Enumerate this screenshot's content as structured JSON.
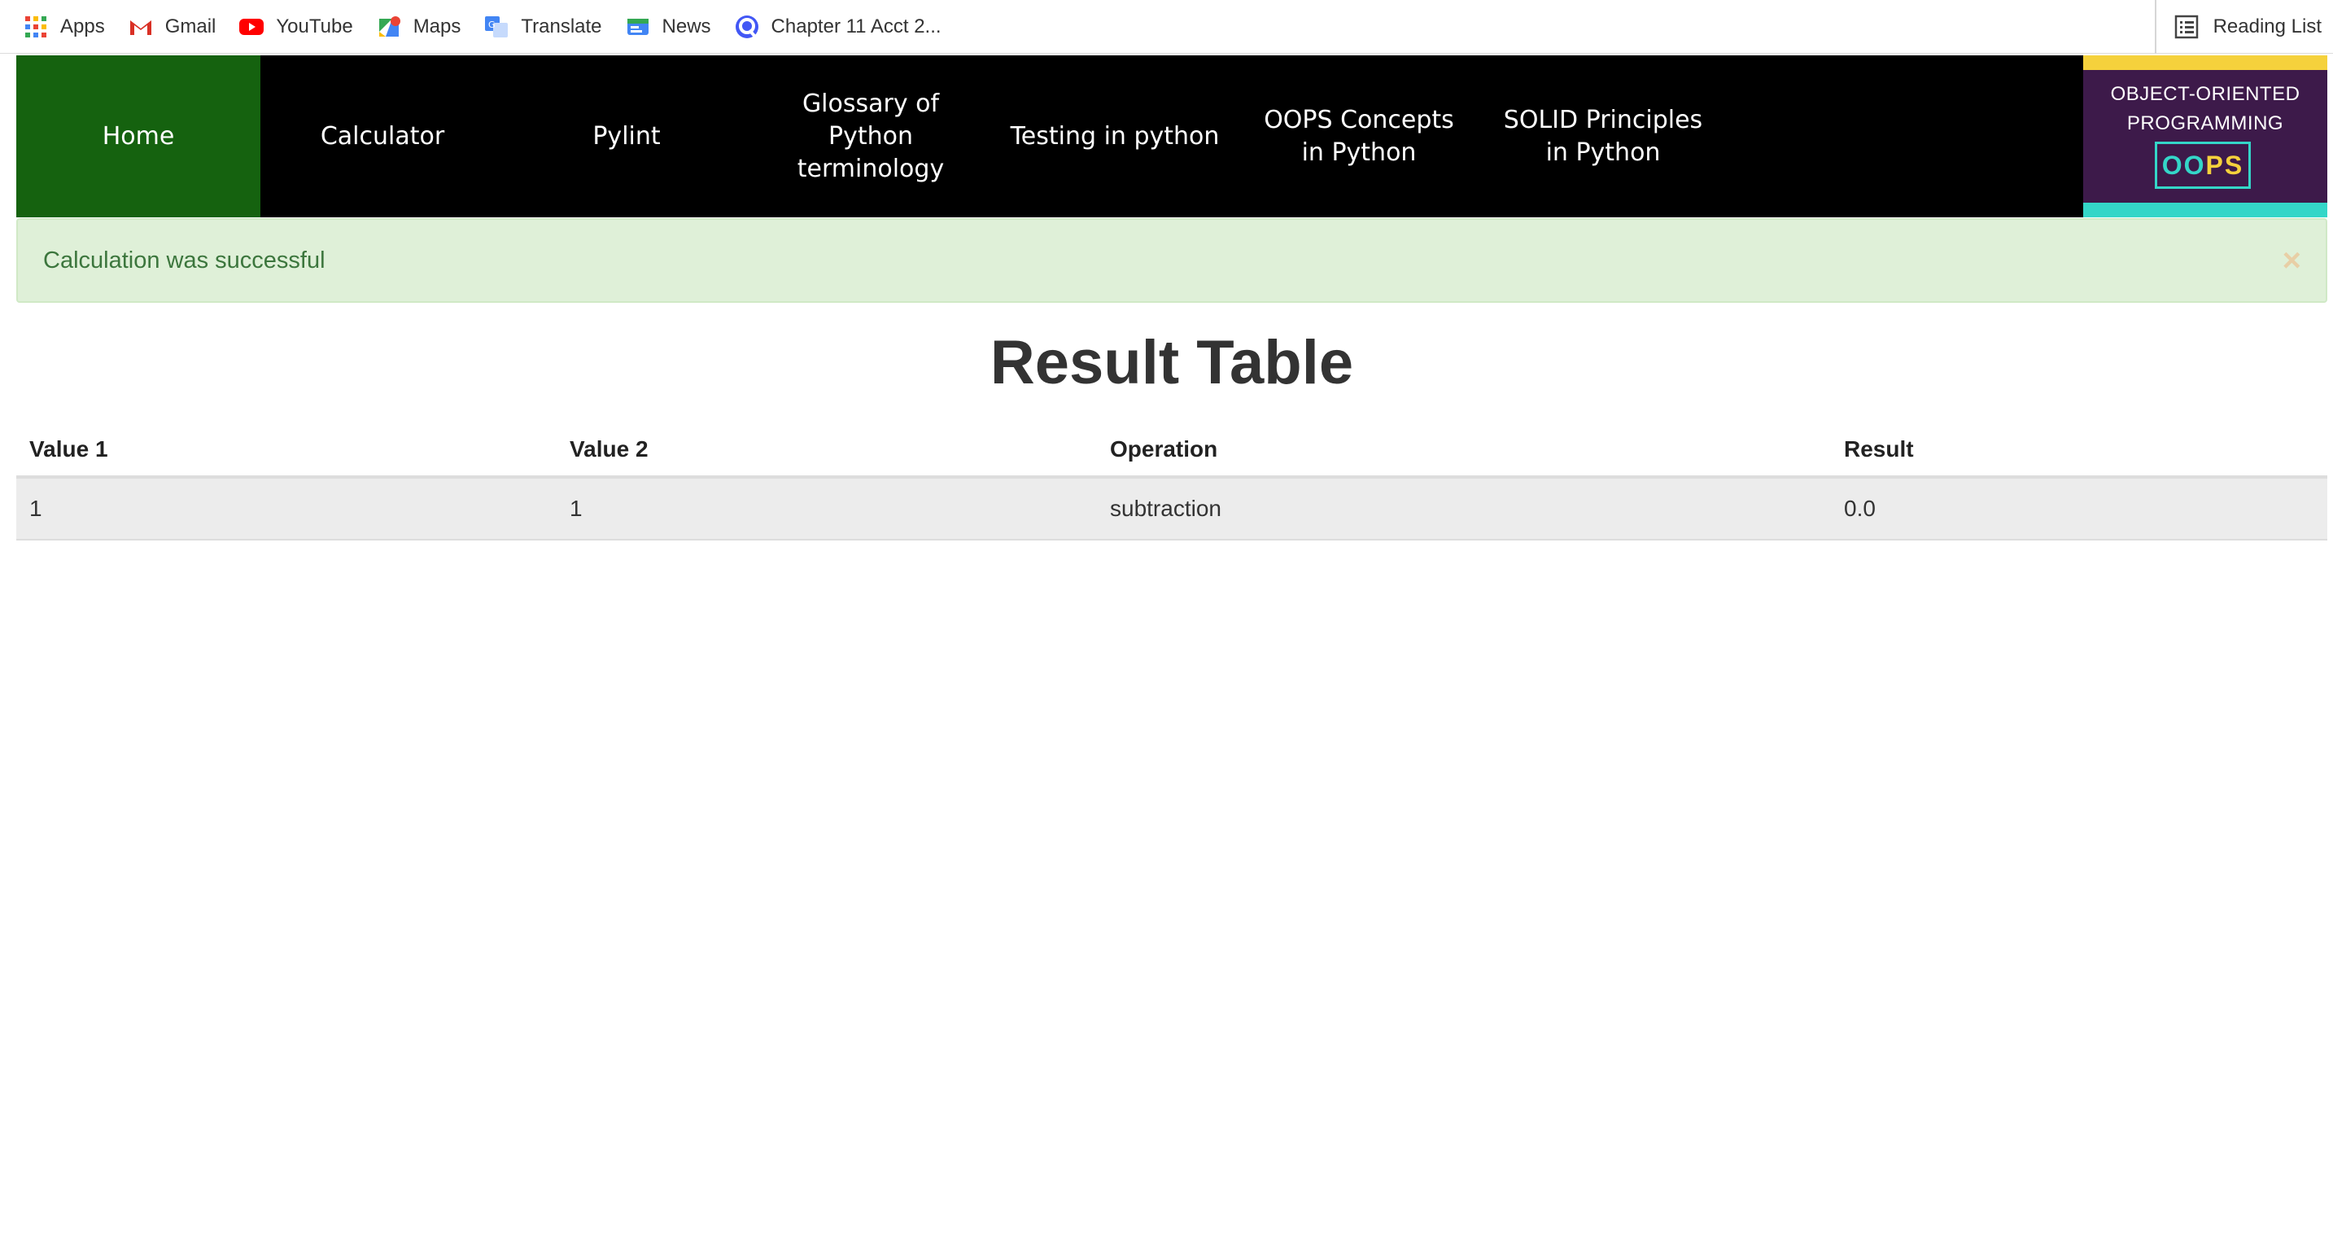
{
  "bookmarks": {
    "items": [
      {
        "label": "Apps",
        "icon": "apps-grid-icon"
      },
      {
        "label": "Gmail",
        "icon": "gmail-icon"
      },
      {
        "label": "YouTube",
        "icon": "youtube-icon"
      },
      {
        "label": "Maps",
        "icon": "maps-icon"
      },
      {
        "label": "Translate",
        "icon": "translate-icon"
      },
      {
        "label": "News",
        "icon": "news-icon"
      },
      {
        "label": "Chapter 11 Acct 2...",
        "icon": "quizlet-icon"
      }
    ],
    "reading_list": "Reading List"
  },
  "nav": {
    "items": [
      {
        "label": "Home",
        "active": true
      },
      {
        "label": "Calculator"
      },
      {
        "label": "Pylint"
      },
      {
        "label": "Glossary of Python terminology"
      },
      {
        "label": "Testing in python"
      },
      {
        "label": "OOPS Concepts in Python"
      },
      {
        "label": "SOLID Principles in Python"
      }
    ],
    "active_color": "#15620f"
  },
  "logo": {
    "line1": "OBJECT-ORIENTED",
    "line2": "PROGRAMMING",
    "badge_o": "OO",
    "badge_ps": "PS"
  },
  "alert": {
    "message": "Calculation was successful",
    "close": "×"
  },
  "page": {
    "title": "Result Table"
  },
  "table": {
    "headers": [
      "Value 1",
      "Value 2",
      "Operation",
      "Result"
    ],
    "rows": [
      [
        "1",
        "1",
        "subtraction",
        "0.0"
      ]
    ]
  }
}
